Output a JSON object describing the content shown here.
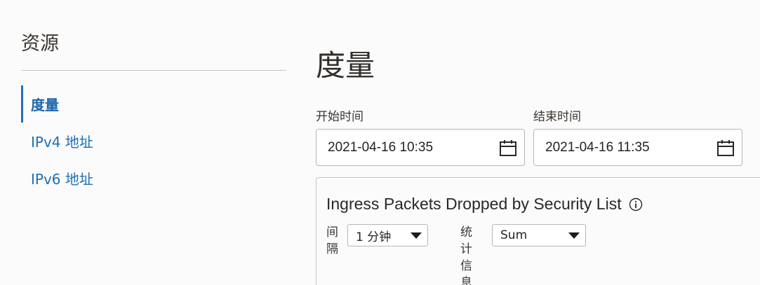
{
  "sidebar": {
    "title": "资源",
    "items": [
      {
        "label": "度量",
        "active": true
      },
      {
        "label": "IPv4 地址",
        "active": false
      },
      {
        "label": "IPv6 地址",
        "active": false
      }
    ]
  },
  "main": {
    "title": "度量",
    "start": {
      "label": "开始时间",
      "value": "2021-04-16 10:35",
      "icon": "calendar-icon"
    },
    "end": {
      "label": "结束时间",
      "value": "2021-04-16 11:35",
      "icon": "calendar-icon"
    }
  },
  "metric": {
    "title": "Ingress Packets Dropped by Security List",
    "info_icon": "info-icon",
    "interval": {
      "label_chars": [
        "间",
        "隔"
      ],
      "value": "1 分钟"
    },
    "statistic": {
      "label_chars": [
        "统",
        "计",
        "信",
        "息"
      ],
      "value": "Sum"
    }
  },
  "colors": {
    "accent": "#1f6fb5",
    "text": "#312d2a",
    "border": "#b9b6b2",
    "background": "#fbfbfb"
  }
}
